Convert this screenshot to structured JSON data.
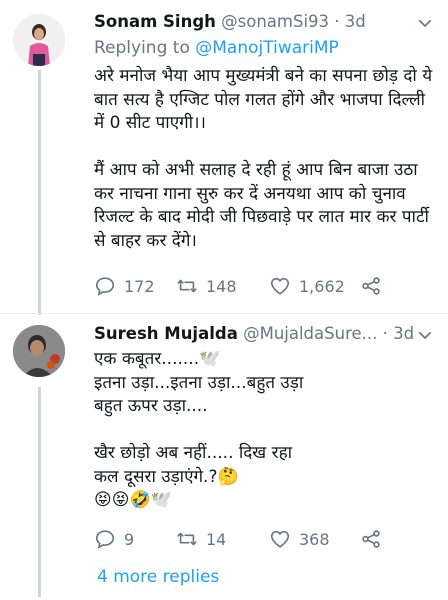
{
  "tweet1": {
    "name": "Sonam Singh",
    "handle": "@sonamSi93",
    "time": "· 3d",
    "replying_prefix": "Replying to ",
    "replying_to": "@ManojTiwariMP",
    "body": "अरे मनोज भैया आप मुख्यमंत्री बने का सपना छोड़ दो ये बात सत्य है एग्जिट पोल गलत होंगे और भाजपा दिल्ली में 0 सीट पाएगी।।\n\nमैं आप को अभी सलाह दे रही हूं आप बिन बाजा उठा कर नाचना गाना सुरु कर दें अनयथा आप को चुनाव रिजल्ट के बाद मोदी जी पिछवाड़े पर लात मार कर पार्टी से बाहर कर देंगे।",
    "replies": "172",
    "retweets": "148",
    "likes": "1,662"
  },
  "tweet2": {
    "name": "Suresh Mujalda",
    "handle": "@MujaldaSure...",
    "time": "· 3d",
    "body": "एक कबूतर.......🕊️\nइतना उड़ा...इतना उड़ा...बहुत उड़ा\nबहुत ऊपर उड़ा....\n\nखैर छोड़ो अब नहीं..... दिख रहा\nकल दूसरा उड़ाएंगे.?🤔\n😝😝🤣🕊️",
    "replies": "9",
    "retweets": "14",
    "likes": "368"
  },
  "more_replies": "4 more replies",
  "icons": {
    "reply": "reply-icon",
    "retweet": "retweet-icon",
    "like": "heart-icon",
    "share": "share-icon",
    "more": "chevron-down-icon"
  },
  "colors": {
    "link": "#1da1f2",
    "muted": "#657786",
    "divider": "#e6ecf0"
  }
}
